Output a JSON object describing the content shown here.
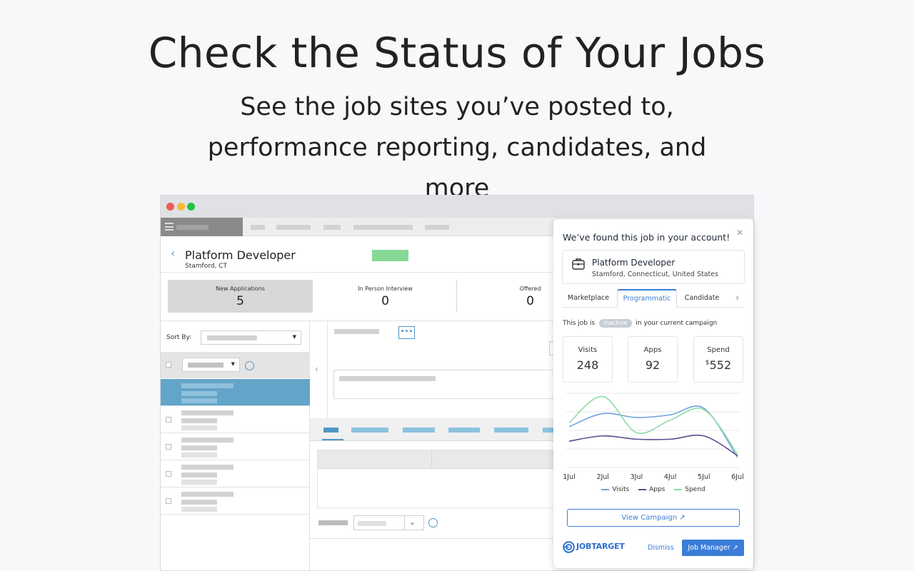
{
  "hero": {
    "title": "Check the Status of Your Jobs",
    "subtitle": "See the job sites you’ve posted to, performance reporting, candidates, and more"
  },
  "app": {
    "job": {
      "title": "Platform Developer",
      "location": "Stamford, CT"
    },
    "stats": [
      {
        "label": "New Applications",
        "value": "5"
      },
      {
        "label": "In Person Interview",
        "value": "0"
      },
      {
        "label": "Offered",
        "value": "0"
      }
    ],
    "sort_label": "Sort By:"
  },
  "card": {
    "title": "We’ve found this job in your account!",
    "job_title": "Platform Developer",
    "job_location": "Stamford, Connecticut, United States",
    "tabs": [
      "Marketplace",
      "Programmatic",
      "Candidate"
    ],
    "active_tab": "Programmatic",
    "status_prefix": "This job is",
    "status_pill": "inactive",
    "status_suffix": "in your current campaign",
    "metrics": [
      {
        "label": "Visits",
        "value": "248"
      },
      {
        "label": "Apps",
        "value": "92"
      },
      {
        "label": "Spend",
        "currency": "$",
        "value": "552"
      }
    ],
    "view_campaign": "View Campaign",
    "logo": "JOBTARGET",
    "dismiss": "Dismiss",
    "job_manager": "Job Manager"
  },
  "chart_data": {
    "type": "line",
    "x": [
      "1Jul",
      "2Jul",
      "3Jul",
      "4Jul",
      "5Jul",
      "6Jul"
    ],
    "series": [
      {
        "name": "Visits",
        "color": "#6fa3e0",
        "values": [
          62,
          82,
          76,
          80,
          90,
          15
        ]
      },
      {
        "name": "Apps",
        "color": "#5b4c8f",
        "values": [
          40,
          48,
          43,
          43,
          48,
          18
        ]
      },
      {
        "name": "Spend",
        "color": "#8fdca6",
        "values": [
          68,
          108,
          53,
          72,
          88,
          20
        ]
      }
    ],
    "ylim": [
      0,
      115
    ],
    "grid": true
  },
  "colors": {
    "accent": "#3b7dd8",
    "selected_row": "#63a5c9",
    "chip": "#86d994"
  }
}
